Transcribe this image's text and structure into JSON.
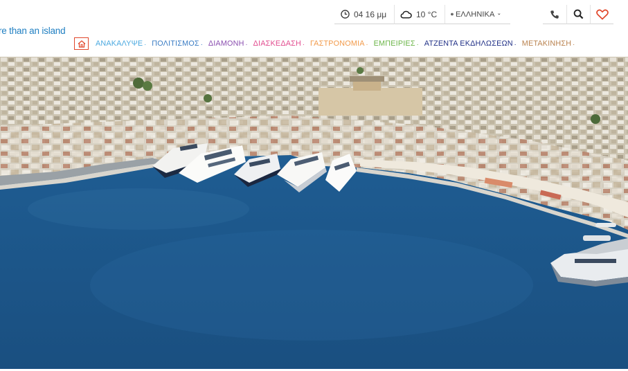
{
  "header": {
    "tagline": "re than an island",
    "time": "04 16 μμ",
    "weather": "10 °C",
    "language": "ΕΛΛΗΝΙΚΑ"
  },
  "nav": [
    {
      "label": "ΑΝΑΚΑΛΥΨΕ",
      "color": "#4aa9e0"
    },
    {
      "label": "ΠΟΛΙΤΙΣΜΟΣ",
      "color": "#3a7cc4"
    },
    {
      "label": "ΔΙΑΜΟΝΗ",
      "color": "#8b4fb0"
    },
    {
      "label": "ΔΙΑΣΚΕΔΑΣΗ",
      "color": "#e24c8f"
    },
    {
      "label": "ΓΑΣΤΡΟΝΟΜΙΑ",
      "color": "#f29a4a"
    },
    {
      "label": "ΕΜΠΕΙΡΙΕΣ",
      "color": "#6bb548"
    },
    {
      "label": "ΑΤΖΕΝΤΑ ΕΚΔΗΛΩΣΕΩΝ",
      "color": "#1f2f86"
    },
    {
      "label": "ΜΕΤΑΚΙΝΗΣΗ",
      "color": "#b9824e"
    }
  ],
  "colors": {
    "accent_red": "#e0462a",
    "tagline_blue": "#1f7fc2",
    "sea": "#1d5d93"
  },
  "icons": [
    "clock-icon",
    "cloud-icon",
    "globe-icon",
    "chevron-down-icon",
    "phone-icon",
    "search-icon",
    "heart-icon",
    "home-icon"
  ]
}
